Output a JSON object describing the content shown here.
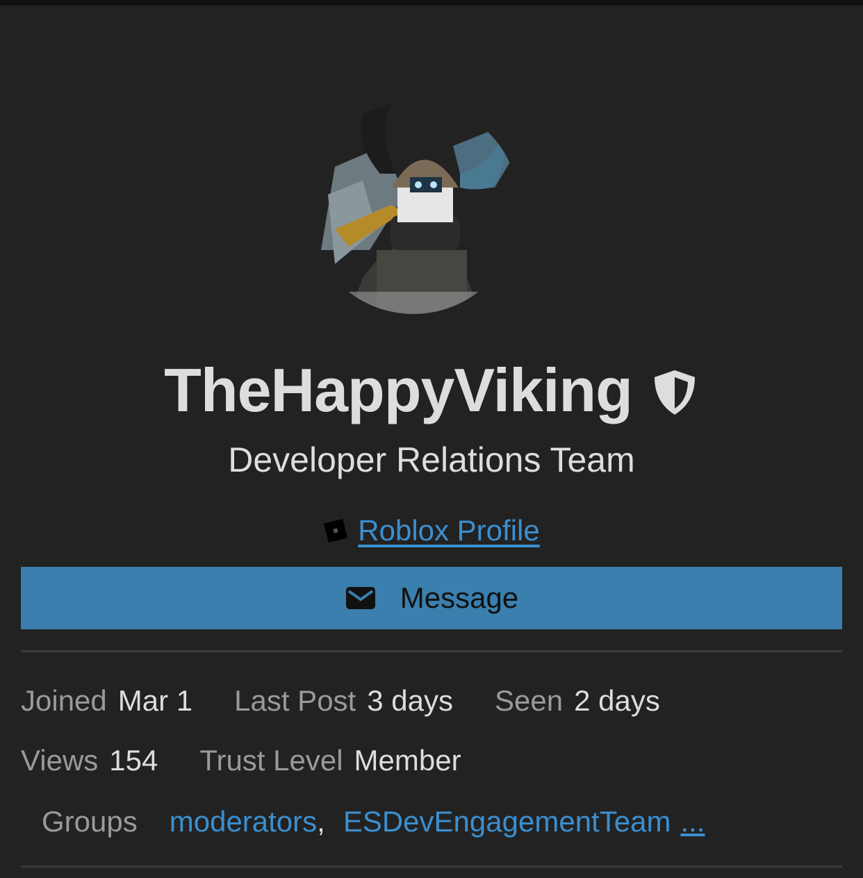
{
  "profile": {
    "username": "TheHappyViking",
    "title": "Developer Relations Team",
    "roblox_link": "Roblox Profile",
    "message_button": "Message",
    "badge_icon": "shield-icon"
  },
  "stats": {
    "joined_label": "Joined",
    "joined_value": "Mar 1",
    "last_post_label": "Last Post",
    "last_post_value": "3 days",
    "seen_label": "Seen",
    "seen_value": "2 days",
    "views_label": "Views",
    "views_value": "154",
    "trust_label": "Trust Level",
    "trust_value": "Member"
  },
  "groups": {
    "label": "Groups",
    "items": [
      "moderators",
      "ESDevEngagementTeam"
    ],
    "separator": ",",
    "more": "..."
  },
  "colors": {
    "background": "#222222",
    "accent": "#3a7fad",
    "link": "#3b8fd0"
  }
}
